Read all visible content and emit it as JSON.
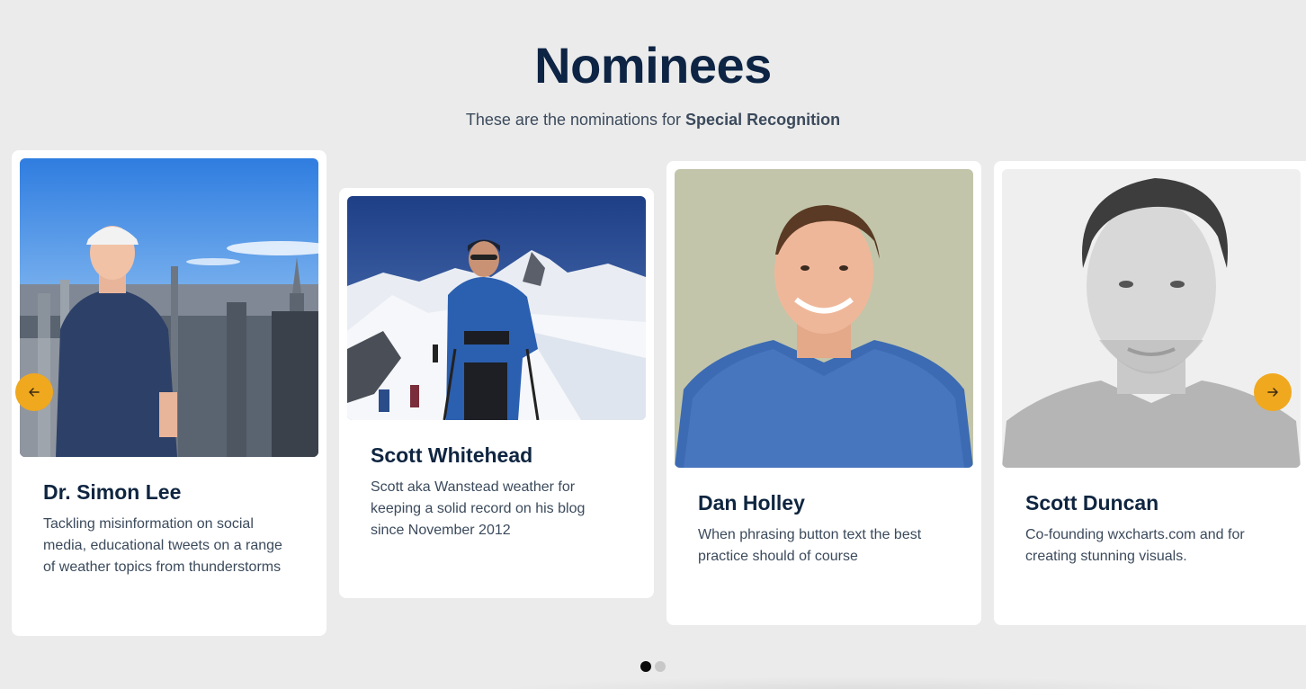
{
  "header": {
    "title": "Nominees",
    "subtitle_prefix": "These are the nominations for ",
    "subtitle_emphasis": "Special Recognition"
  },
  "nominees": [
    {
      "name": "Dr. Simon Lee",
      "description": "Tackling misinformation on social media, educational tweets on a range of weather topics from thunderstorms",
      "photo_icon": "person-city-skyline-photo"
    },
    {
      "name": "Scott Whitehead",
      "description": "Scott aka Wanstead weather for keeping a solid record on his blog since November 2012",
      "photo_icon": "person-snowy-mountain-photo"
    },
    {
      "name": "Dan Holley",
      "description": "When phrasing button text the best practice should of course",
      "photo_icon": "person-portrait-photo"
    },
    {
      "name": "Scott Duncan",
      "description": "Co-founding wxcharts.com and for creating stunning visuals.",
      "photo_icon": "person-bw-portrait-photo"
    }
  ],
  "carousel": {
    "prev_icon": "arrow-left-icon",
    "next_icon": "arrow-right-icon",
    "page_count": 2,
    "active_page": 1
  },
  "colors": {
    "background": "#ebebeb",
    "accent": "#f0a81e",
    "title": "#0d2444",
    "text": "#3b4a5c"
  }
}
